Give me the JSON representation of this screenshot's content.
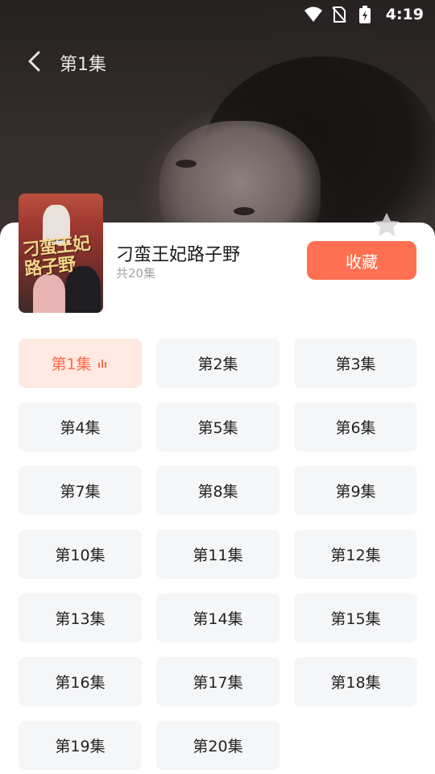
{
  "status_bar": {
    "time": "4:19"
  },
  "header": {
    "title": "第1集"
  },
  "drama": {
    "title": "刁蛮王妃路子野",
    "episode_count": "共20集",
    "cover_text": "刁蛮王妃路子野",
    "collect_label": "收藏"
  },
  "episodes": [
    "第1集",
    "第2集",
    "第3集",
    "第4集",
    "第5集",
    "第6集",
    "第7集",
    "第8集",
    "第9集",
    "第10集",
    "第11集",
    "第12集",
    "第13集",
    "第14集",
    "第15集",
    "第16集",
    "第17集",
    "第18集",
    "第19集",
    "第20集"
  ],
  "current_episode": 1,
  "colors": {
    "accent": "#ff7052",
    "active_bg": "#ffe9e0",
    "active_text": "#ff6a4a",
    "tile_bg": "#f5f6f8"
  }
}
